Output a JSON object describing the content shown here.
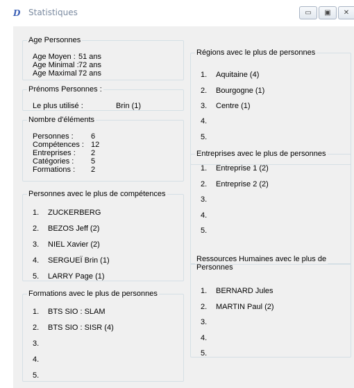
{
  "window": {
    "title": "Statistiques",
    "icon": "app-logo-icon",
    "buttons": {
      "minimize": "minimize-icon",
      "maximize": "maximize-icon",
      "close": "close-icon"
    }
  },
  "age": {
    "legend": "Age Personnes",
    "rows": [
      {
        "label": "Age Moyen :",
        "value": "51 ans"
      },
      {
        "label": "Age Minimal :",
        "value": "72 ans"
      },
      {
        "label": "Age Maximal :",
        "value": "72 ans"
      }
    ]
  },
  "prenoms": {
    "legend": "Prénoms Personnes :",
    "label": "Le plus utilisé :",
    "value": "Brin (1)"
  },
  "elements": {
    "legend": "Nombre d'éléments",
    "rows": [
      {
        "label": "Personnes :",
        "value": "6"
      },
      {
        "label": "Compétences :",
        "value": "12"
      },
      {
        "label": "Entreprises :",
        "value": "2"
      },
      {
        "label": "Catégories :",
        "value": "5"
      },
      {
        "label": "Formations :",
        "value": "2"
      }
    ]
  },
  "competences": {
    "legend": "Personnes avec le plus de compétences",
    "items": [
      {
        "num": "1.",
        "text": "ZUCKERBERG"
      },
      {
        "num": "2.",
        "text": "BEZOS Jeff (2)"
      },
      {
        "num": "3.",
        "text": "NIEL Xavier (2)"
      },
      {
        "num": "4.",
        "text": "SERGUEÏ Brin (1)"
      },
      {
        "num": "5.",
        "text": "LARRY Page (1)"
      }
    ]
  },
  "formations": {
    "legend": "Formations avec le plus de personnes",
    "items": [
      {
        "num": "1.",
        "text": "BTS SIO : SLAM"
      },
      {
        "num": "2.",
        "text": "BTS SIO : SISR (4)"
      },
      {
        "num": "3.",
        "text": ""
      },
      {
        "num": "4.",
        "text": ""
      },
      {
        "num": "5.",
        "text": ""
      }
    ]
  },
  "regions": {
    "legend": "Régions avec le plus de personnes",
    "items": [
      {
        "num": "1.",
        "text": "Aquitaine (4)"
      },
      {
        "num": "2.",
        "text": "Bourgogne (1)"
      },
      {
        "num": "3.",
        "text": "Centre (1)"
      },
      {
        "num": "4.",
        "text": ""
      },
      {
        "num": "5.",
        "text": ""
      }
    ]
  },
  "entreprises": {
    "legend": "Entreprises avec le plus de personnes",
    "items": [
      {
        "num": "1.",
        "text": "Entreprise 1 (2)"
      },
      {
        "num": "2.",
        "text": "Entreprise 2 (2)"
      },
      {
        "num": "3.",
        "text": ""
      },
      {
        "num": "4.",
        "text": ""
      },
      {
        "num": "5.",
        "text": ""
      }
    ]
  },
  "rh": {
    "legend_line1": "Ressources Humaines avec le plus de",
    "legend_line2": "Personnes",
    "items": [
      {
        "num": "1.",
        "text": "BERNARD Jules"
      },
      {
        "num": "2.",
        "text": "MARTIN Paul (2)"
      },
      {
        "num": "3.",
        "text": ""
      },
      {
        "num": "4.",
        "text": ""
      },
      {
        "num": "5.",
        "text": ""
      }
    ]
  }
}
